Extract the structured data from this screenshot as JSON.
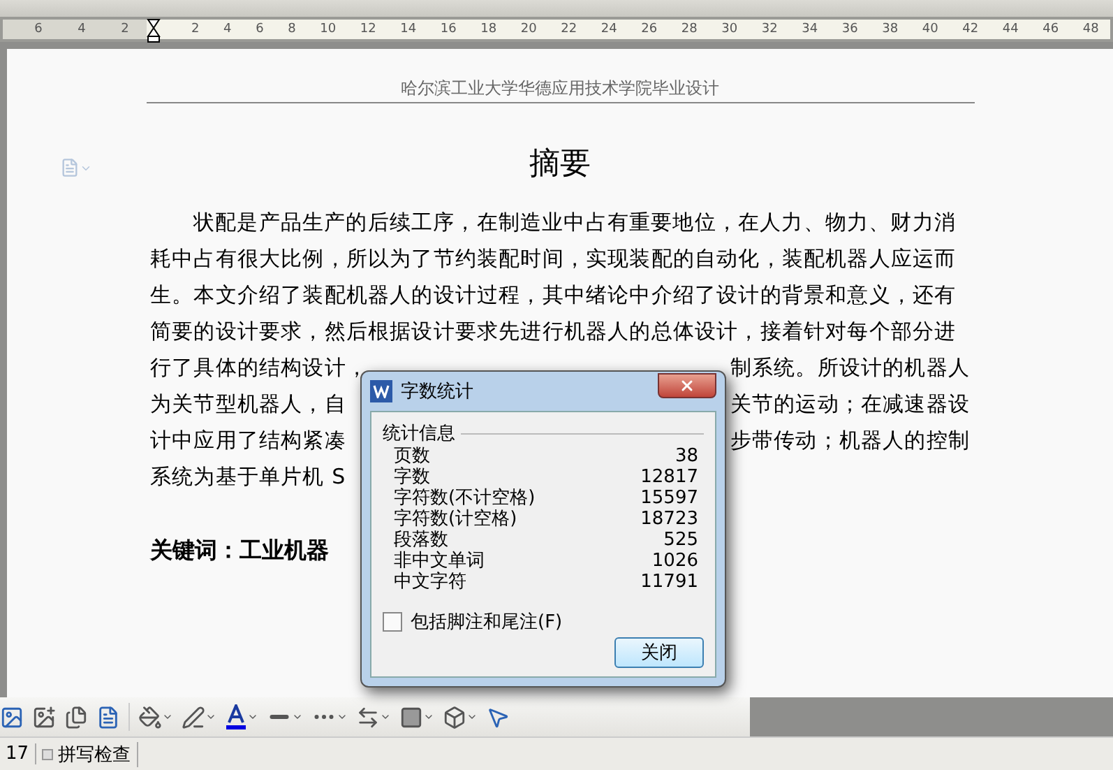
{
  "ruler": {
    "left_ticks": [
      "6",
      "4",
      "2"
    ],
    "right_ticks": [
      "2",
      "4",
      "6",
      "8",
      "10",
      "12",
      "14",
      "16",
      "18",
      "20",
      "22",
      "24",
      "26",
      "28",
      "30",
      "32",
      "34",
      "36",
      "38",
      "40",
      "42",
      "44",
      "46",
      "48"
    ]
  },
  "document": {
    "header": "哈尔滨工业大学华德应用技术学院毕业设计",
    "title": "摘要",
    "lines": [
      {
        "left": "状配是产品生产的后续工序，在制造业中占有重要地位，在人力、物力、财力消",
        "indent": true
      },
      {
        "left": "耗中占有很大比例，所以为了节约装配时间，实现装配的自动化，装配机器人应运而",
        "indent": false
      },
      {
        "left": "生。本文介绍了装配机器人的设计过程，其中绪论中介绍了设计的背景和意义，还有",
        "indent": false
      },
      {
        "left": "简要的设计要求，然后根据设计要求先进行机器人的总体设计，接着针对每个部分进",
        "indent": false
      },
      {
        "left": "行了具体的结构设计，",
        "right": "制系统。所设计的机器人",
        "indent": false
      },
      {
        "left": "为关节型机器人，自",
        "right": "关节的运动；在减速器设",
        "indent": false
      },
      {
        "left": "计中应用了结构紧凑",
        "right": "步带传动；机器人的控制",
        "indent": false
      },
      {
        "left": "系统为基于单片机 S",
        "indent": false
      }
    ],
    "keywords": "关键词：工业机器"
  },
  "dialog": {
    "title": "字数统计",
    "group": "统计信息",
    "rows": [
      {
        "label": "页数",
        "value": "38"
      },
      {
        "label": "字数",
        "value": "12817"
      },
      {
        "label": "字符数(不计空格)",
        "value": "15597"
      },
      {
        "label": "字符数(计空格)",
        "value": "18723"
      },
      {
        "label": "段落数",
        "value": "525"
      },
      {
        "label": "非中文单词",
        "value": "1026"
      },
      {
        "label": "中文字符",
        "value": "11791"
      }
    ],
    "checkbox": {
      "label": "包括脚注和尾注(F)",
      "checked": false
    },
    "button": "关闭"
  },
  "status_bar": {
    "page": "17",
    "spell_check": "拼写检查"
  }
}
